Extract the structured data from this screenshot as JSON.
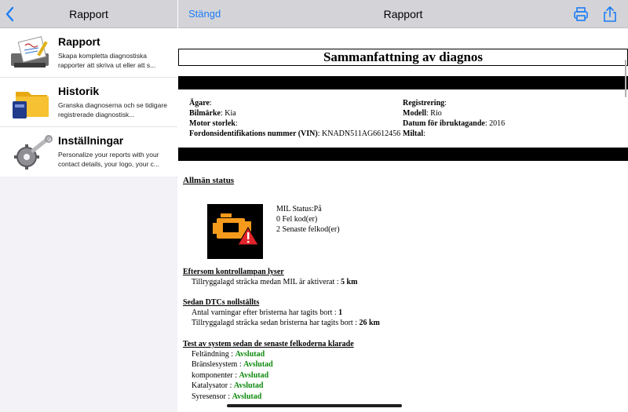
{
  "sidebar": {
    "title": "Rapport",
    "items": [
      {
        "title": "Rapport",
        "subtitle": "Skapa kompletta diagnostiska rapporter att skriva ut eller att s..."
      },
      {
        "title": "Historik",
        "subtitle": "Granska diagnoserna och se tidigare registrerade diagnostisk..."
      },
      {
        "title": "Inställningar",
        "subtitle": "Personalize your reports with your contact details, your logo, your c..."
      }
    ]
  },
  "header": {
    "close_label": "Stängd",
    "title": "Rapport"
  },
  "report": {
    "title": "Sammanfattning av diagnos",
    "vehicle": {
      "owner_label": "Ägare",
      "owner_value": "",
      "make_label": "Bilmärke",
      "make_value": "Kia",
      "engine_label": "Motor storlek",
      "engine_value": "",
      "vin_label": "Fordonsidentifikations nummer (VIN)",
      "vin_value": "KNADN511AG6612456",
      "reg_label": "Registrering",
      "reg_value": "",
      "model_label": "Modell",
      "model_value": "Rio",
      "date_label": "Datum för ibruktagande",
      "date_value": "2016",
      "mileage_label": "Miltal",
      "mileage_value": ""
    },
    "general_status": {
      "heading": "Allmän status",
      "mil_status": "MIL Status:På",
      "fault_codes": "0 Fel kod(er)",
      "pending_codes": "2 Senaste felkod(er)"
    },
    "mil_on": {
      "heading": "Eftersom kontrollampan lyser",
      "distance_label": "Tillryggalagd sträcka medan MIL är aktiverat :",
      "distance_value": "5 km"
    },
    "since_cleared": {
      "heading": "Sedan DTCs nollställts",
      "warmups_label": "Antal varningar efter bristerna har tagits bort :",
      "warmups_value": "1",
      "distance_label": "Tillryggalagd sträcka sedan bristerna har tagits bort :",
      "distance_value": "26 km"
    },
    "tests": {
      "heading": "Test av system sedan de senaste felkoderna klarade",
      "items": [
        {
          "label": "Feltändning :",
          "value": "Avslutad"
        },
        {
          "label": "Bränslesystem :",
          "value": "Avslutad"
        },
        {
          "label": "komponenter :",
          "value": "Avslutad"
        },
        {
          "label": "Katalysator :",
          "value": "Avslutad"
        },
        {
          "label": "Syresensor :",
          "value": "Avslutad"
        }
      ]
    }
  },
  "colors": {
    "accent": "#1a7cf5",
    "status_ok": "#0d8a0d",
    "engine_icon": "#f59a1b",
    "warning": "#e3242b"
  },
  "icons": [
    "chevron-left-icon",
    "printer-icon",
    "share-icon",
    "report-printer-icon",
    "folder-icon",
    "tools-icon",
    "check-engine-icon"
  ]
}
